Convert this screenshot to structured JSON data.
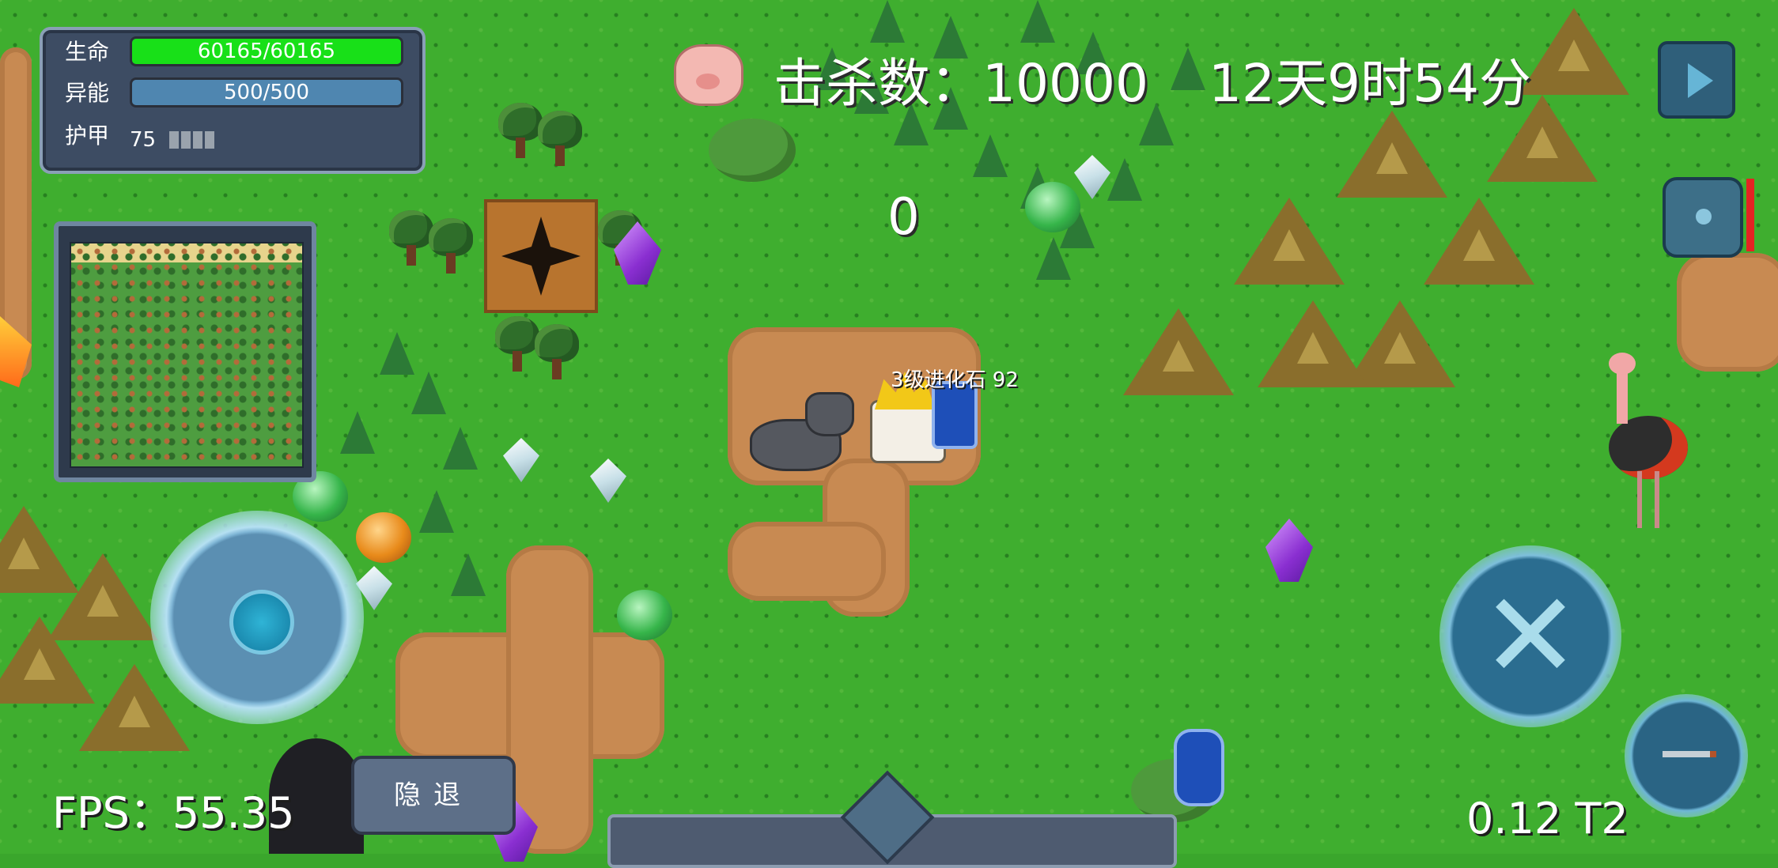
{
  "stats": {
    "hp_label": "生命",
    "hp_value": "60165/60165",
    "hp_fraction": 1.0,
    "energy_label": "异能",
    "energy_value": "500/500",
    "energy_fraction": 1.0,
    "armor_label": "护甲",
    "armor_value": "75"
  },
  "hud": {
    "kills": "击杀数：10000",
    "time": "12天9时54分",
    "combo": "0",
    "pickup": "3级进化石 92",
    "fps": "FPS：55.35",
    "version": "0.12 T2",
    "retreat_label": "隐退"
  },
  "icons": {
    "pig": "pig-icon",
    "play": "play-icon",
    "bag": "bag-icon",
    "joystick": "joystick-icon",
    "attack": "crossed-swords-icon",
    "skill": "knife-icon"
  },
  "colors": {
    "hp_fill": "#18e018",
    "energy_fill": "#4f86b0",
    "hud_panel": "#3d4c63",
    "grass": "#3fae2f",
    "dirt": "#c88a52"
  }
}
